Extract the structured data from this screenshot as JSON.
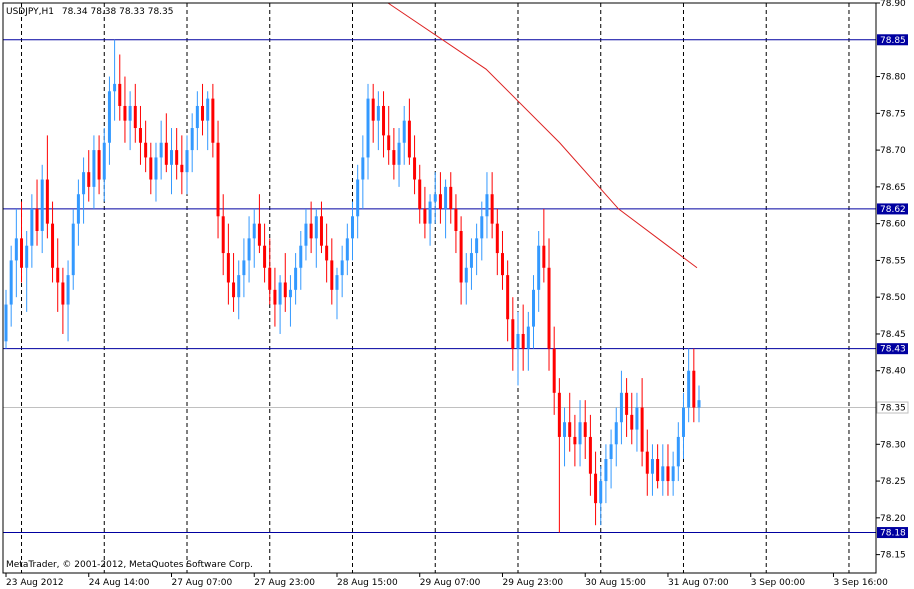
{
  "header": {
    "symbol": "USDJPY,H1",
    "ohlc": "78.34 78.38 78.33 78.35"
  },
  "footer": {
    "copyright": "MetaTrader, © 2001-2012, MetaQuotes Software Corp."
  },
  "colors": {
    "background": "#ffffff",
    "frame": "#000000",
    "bullish": "#3399ff",
    "bearish": "#ff0000",
    "level_line": "#0000a0",
    "trend_line": "#dd2222",
    "current_price_line": "#c0c0c0",
    "label_box": "#0000a0",
    "label_text": "#ffffff"
  },
  "chart_data": {
    "type": "candlestick",
    "instrument": "USDJPY",
    "timeframe": "H1",
    "ylim": [
      78.125,
      78.9
    ],
    "y_ticks": [
      78.9,
      78.8,
      78.75,
      78.7,
      78.65,
      78.6,
      78.55,
      78.5,
      78.45,
      78.4,
      78.3,
      78.25,
      78.2,
      78.15
    ],
    "x_tick_labels": [
      "23 Aug 2012",
      "24 Aug 14:00",
      "27 Aug 07:00",
      "27 Aug 23:00",
      "28 Aug 15:00",
      "29 Aug 07:00",
      "29 Aug 23:00",
      "30 Aug 15:00",
      "31 Aug 07:00",
      "3 Sep 00:00",
      "3 Sep 16:00"
    ],
    "horizontal_levels": [
      78.85,
      78.62,
      78.43,
      78.18
    ],
    "current_price": 78.35,
    "trend_line": [
      [
        78.9,
        0
      ],
      [
        78.81,
        0.2
      ],
      [
        78.71,
        0.35
      ],
      [
        78.62,
        0.47
      ],
      [
        78.57,
        0.57
      ],
      [
        78.54,
        0.63
      ]
    ],
    "candles": [
      [
        78.44,
        78.51,
        78.43,
        78.49
      ],
      [
        78.49,
        78.57,
        78.46,
        78.55
      ],
      [
        78.55,
        78.62,
        78.5,
        78.58
      ],
      [
        78.58,
        78.63,
        78.52,
        78.54
      ],
      [
        78.54,
        78.59,
        78.48,
        78.57
      ],
      [
        78.57,
        78.64,
        78.54,
        78.62
      ],
      [
        78.62,
        78.66,
        78.57,
        78.59
      ],
      [
        78.59,
        78.68,
        78.56,
        78.66
      ],
      [
        78.66,
        78.72,
        78.58,
        78.6
      ],
      [
        78.6,
        78.63,
        78.52,
        78.54
      ],
      [
        78.54,
        78.58,
        78.48,
        78.52
      ],
      [
        78.52,
        78.54,
        78.45,
        78.49
      ],
      [
        78.49,
        78.55,
        78.44,
        78.53
      ],
      [
        78.53,
        78.62,
        78.51,
        78.6
      ],
      [
        78.6,
        78.66,
        78.57,
        78.64
      ],
      [
        78.64,
        78.69,
        78.6,
        78.67
      ],
      [
        78.67,
        78.7,
        78.63,
        78.65
      ],
      [
        78.65,
        78.72,
        78.62,
        78.7
      ],
      [
        78.7,
        78.72,
        78.64,
        78.66
      ],
      [
        78.66,
        78.73,
        78.63,
        78.71
      ],
      [
        78.71,
        78.8,
        78.68,
        78.78
      ],
      [
        78.78,
        78.85,
        78.74,
        78.79
      ],
      [
        78.79,
        78.83,
        78.74,
        78.76
      ],
      [
        78.76,
        78.8,
        78.71,
        78.74
      ],
      [
        78.74,
        78.78,
        78.7,
        78.76
      ],
      [
        78.76,
        78.79,
        78.71,
        78.73
      ],
      [
        78.73,
        78.76,
        78.68,
        78.71
      ],
      [
        78.71,
        78.74,
        78.67,
        78.69
      ],
      [
        78.69,
        78.71,
        78.64,
        78.66
      ],
      [
        78.66,
        78.71,
        78.63,
        78.69
      ],
      [
        78.69,
        78.74,
        78.66,
        78.71
      ],
      [
        78.71,
        78.75,
        78.67,
        78.68
      ],
      [
        78.68,
        78.73,
        78.64,
        78.7
      ],
      [
        78.7,
        78.73,
        78.66,
        78.68
      ],
      [
        78.68,
        78.72,
        78.64,
        78.67
      ],
      [
        78.67,
        78.72,
        78.64,
        78.7
      ],
      [
        78.7,
        78.75,
        78.67,
        78.73
      ],
      [
        78.73,
        78.78,
        78.7,
        78.76
      ],
      [
        78.76,
        78.79,
        78.72,
        78.74
      ],
      [
        78.74,
        78.78,
        78.7,
        78.77
      ],
      [
        78.77,
        78.79,
        78.69,
        78.71
      ],
      [
        78.71,
        78.74,
        78.58,
        78.61
      ],
      [
        78.61,
        78.64,
        78.53,
        78.56
      ],
      [
        78.56,
        78.6,
        78.49,
        78.52
      ],
      [
        78.52,
        78.56,
        78.48,
        78.5
      ],
      [
        78.5,
        78.55,
        78.47,
        78.53
      ],
      [
        78.53,
        78.58,
        78.5,
        78.55
      ],
      [
        78.55,
        78.61,
        78.52,
        78.58
      ],
      [
        78.58,
        78.62,
        78.54,
        78.6
      ],
      [
        78.6,
        78.64,
        78.56,
        78.57
      ],
      [
        78.57,
        78.6,
        78.52,
        78.54
      ],
      [
        78.54,
        78.58,
        78.49,
        78.51
      ],
      [
        78.51,
        78.54,
        78.46,
        78.49
      ],
      [
        78.49,
        78.53,
        78.45,
        78.52
      ],
      [
        78.52,
        78.56,
        78.48,
        78.5
      ],
      [
        78.5,
        78.53,
        78.46,
        78.51
      ],
      [
        78.51,
        78.56,
        78.49,
        78.54
      ],
      [
        78.54,
        78.59,
        78.51,
        78.57
      ],
      [
        78.57,
        78.62,
        78.55,
        78.6
      ],
      [
        78.6,
        78.63,
        78.56,
        78.58
      ],
      [
        78.58,
        78.62,
        78.54,
        78.61
      ],
      [
        78.61,
        78.63,
        78.56,
        78.57
      ],
      [
        78.57,
        78.6,
        78.52,
        78.55
      ],
      [
        78.55,
        78.58,
        78.49,
        78.51
      ],
      [
        78.51,
        78.54,
        78.47,
        78.53
      ],
      [
        78.53,
        78.57,
        78.5,
        78.55
      ],
      [
        78.55,
        78.6,
        78.53,
        78.58
      ],
      [
        78.58,
        78.63,
        78.55,
        78.61
      ],
      [
        78.61,
        78.68,
        78.58,
        78.66
      ],
      [
        78.66,
        78.72,
        78.62,
        78.69
      ],
      [
        78.69,
        78.79,
        78.66,
        78.77
      ],
      [
        78.77,
        78.79,
        78.71,
        78.74
      ],
      [
        78.74,
        78.78,
        78.7,
        78.76
      ],
      [
        78.76,
        78.78,
        78.69,
        78.72
      ],
      [
        78.72,
        78.76,
        78.68,
        78.7
      ],
      [
        78.7,
        78.73,
        78.66,
        78.68
      ],
      [
        78.68,
        78.73,
        78.65,
        78.71
      ],
      [
        78.71,
        78.76,
        78.68,
        78.74
      ],
      [
        78.74,
        78.77,
        78.68,
        78.69
      ],
      [
        78.69,
        78.72,
        78.64,
        78.66
      ],
      [
        78.66,
        78.68,
        78.6,
        78.62
      ],
      [
        78.62,
        78.65,
        78.58,
        78.6
      ],
      [
        78.6,
        78.64,
        78.57,
        78.63
      ],
      [
        78.63,
        78.67,
        78.6,
        78.64
      ],
      [
        78.64,
        78.67,
        78.6,
        78.62
      ],
      [
        78.62,
        78.66,
        78.58,
        78.65
      ],
      [
        78.65,
        78.67,
        78.6,
        78.62
      ],
      [
        78.62,
        78.64,
        78.56,
        78.59
      ],
      [
        78.59,
        78.61,
        78.49,
        78.52
      ],
      [
        78.52,
        78.56,
        78.49,
        78.54
      ],
      [
        78.54,
        78.58,
        78.51,
        78.56
      ],
      [
        78.56,
        78.6,
        78.53,
        78.58
      ],
      [
        78.58,
        78.63,
        78.55,
        78.61
      ],
      [
        78.61,
        78.67,
        78.58,
        78.64
      ],
      [
        78.64,
        78.67,
        78.58,
        78.6
      ],
      [
        78.6,
        78.62,
        78.53,
        78.56
      ],
      [
        78.56,
        78.59,
        78.51,
        78.53
      ],
      [
        78.53,
        78.55,
        78.44,
        78.47
      ],
      [
        78.47,
        78.5,
        78.4,
        78.43
      ],
      [
        78.43,
        78.48,
        78.38,
        78.45
      ],
      [
        78.45,
        78.49,
        78.4,
        78.43
      ],
      [
        78.43,
        78.48,
        78.4,
        78.46
      ],
      [
        78.46,
        78.53,
        78.43,
        78.51
      ],
      [
        78.51,
        78.59,
        78.48,
        78.57
      ],
      [
        78.57,
        78.62,
        78.52,
        78.54
      ],
      [
        78.54,
        78.58,
        78.4,
        78.43
      ],
      [
        78.43,
        78.46,
        78.34,
        78.37
      ],
      [
        78.37,
        78.39,
        78.18,
        78.31
      ],
      [
        78.31,
        78.35,
        78.27,
        78.33
      ],
      [
        78.33,
        78.37,
        78.29,
        78.31
      ],
      [
        78.31,
        78.34,
        78.27,
        78.3
      ],
      [
        78.3,
        78.36,
        78.27,
        78.33
      ],
      [
        78.33,
        78.36,
        78.28,
        78.31
      ],
      [
        78.31,
        78.34,
        78.23,
        78.26
      ],
      [
        78.26,
        78.29,
        78.19,
        78.22
      ],
      [
        78.22,
        78.27,
        78.19,
        78.25
      ],
      [
        78.25,
        78.3,
        78.22,
        78.28
      ],
      [
        78.28,
        78.32,
        78.24,
        78.3
      ],
      [
        78.3,
        78.35,
        78.27,
        78.33
      ],
      [
        78.33,
        78.4,
        78.3,
        78.37
      ],
      [
        78.37,
        78.39,
        78.31,
        78.34
      ],
      [
        78.34,
        78.37,
        78.3,
        78.32
      ],
      [
        78.32,
        78.37,
        78.29,
        78.35
      ],
      [
        78.35,
        78.39,
        78.27,
        78.29
      ],
      [
        78.29,
        78.32,
        78.23,
        78.26
      ],
      [
        78.26,
        78.3,
        78.23,
        78.28
      ],
      [
        78.28,
        78.3,
        78.24,
        78.25
      ],
      [
        78.25,
        78.3,
        78.23,
        78.27
      ],
      [
        78.27,
        78.3,
        78.23,
        78.25
      ],
      [
        78.25,
        78.29,
        78.23,
        78.27
      ],
      [
        78.27,
        78.33,
        78.25,
        78.31
      ],
      [
        78.31,
        78.37,
        78.28,
        78.35
      ],
      [
        78.35,
        78.43,
        78.33,
        78.4
      ],
      [
        78.4,
        78.43,
        78.33,
        78.35
      ],
      [
        78.35,
        78.38,
        78.33,
        78.36
      ]
    ]
  }
}
